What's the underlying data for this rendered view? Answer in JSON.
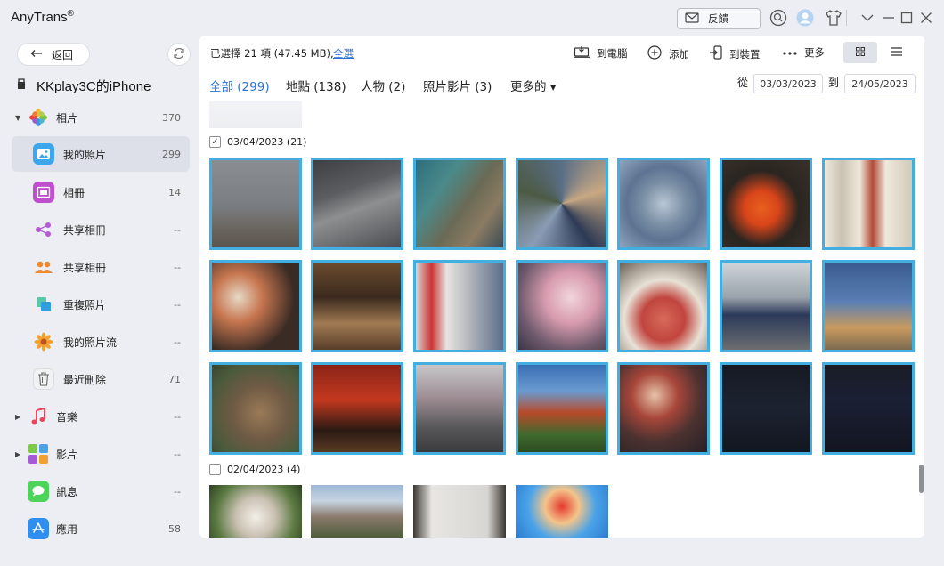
{
  "app": {
    "title": "AnyTrans",
    "reg": "®"
  },
  "titlebar": {
    "feedback_label": "反饋"
  },
  "sidebar": {
    "back_label": "返回",
    "device_name": "KKplay3C的iPhone",
    "items": [
      {
        "label": "相片",
        "count": "370",
        "icon": "photos-icon",
        "expandable": true
      },
      {
        "label": "我的照片",
        "count": "299",
        "icon": "my-photos-icon",
        "active": true
      },
      {
        "label": "相冊",
        "count": "14",
        "icon": "album-icon"
      },
      {
        "label": "共享相冊",
        "count": "--",
        "icon": "shared-album-icon"
      },
      {
        "label": "共享相冊",
        "count": "--",
        "icon": "people-album-icon"
      },
      {
        "label": "重複照片",
        "count": "--",
        "icon": "duplicate-icon"
      },
      {
        "label": "我的照片流",
        "count": "--",
        "icon": "photo-stream-icon"
      },
      {
        "label": "最近刪除",
        "count": "71",
        "icon": "trash-icon"
      },
      {
        "label": "音樂",
        "count": "--",
        "icon": "music-icon",
        "expandable": true
      },
      {
        "label": "影片",
        "count": "--",
        "icon": "video-icon",
        "expandable": true
      },
      {
        "label": "訊息",
        "count": "--",
        "icon": "messages-icon"
      },
      {
        "label": "應用",
        "count": "58",
        "icon": "app-store-icon"
      }
    ]
  },
  "toolbar": {
    "selected_text": "已選擇 21 項 (47.45 MB),",
    "select_all": "全選",
    "to_computer": "到電腦",
    "add": "添加",
    "to_device": "到裝置",
    "more": "更多"
  },
  "tabs": [
    {
      "label": "全部 (299)",
      "active": true
    },
    {
      "label": "地點 (138)"
    },
    {
      "label": "人物 (2)"
    },
    {
      "label": "照片影片 (3)"
    },
    {
      "label": "更多的 ▾"
    }
  ],
  "date_filter": {
    "from_label": "從",
    "from": "03/03/2023",
    "to_label": "到",
    "to": "24/05/2023"
  },
  "groups": [
    {
      "date": "03/04/2023 (21)",
      "checked": true
    },
    {
      "date": "02/04/2023 (4)",
      "checked": false
    }
  ],
  "colors": {
    "accent": "#2a6fd8",
    "selection": "#43aee0"
  }
}
